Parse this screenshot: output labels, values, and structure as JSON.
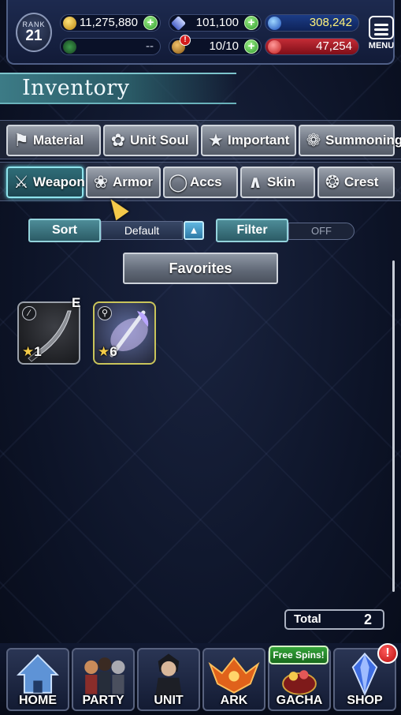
{
  "status": {
    "rank_label": "RANK",
    "rank_value": "21",
    "gil": "11,275,880",
    "lapis": "101,100",
    "visiore": "308,242",
    "exp": "--",
    "stamina": "10/10",
    "hp": "47,254",
    "stamina_alert": "!"
  },
  "menu": {
    "label": "MENU"
  },
  "title": "Inventory",
  "tabs_row1": [
    {
      "label": "Material",
      "icon": "sack-icon"
    },
    {
      "label": "Unit Soul",
      "icon": "soul-flame-icon"
    },
    {
      "label": "Important",
      "icon": "star-icon"
    },
    {
      "label": "Summoning",
      "icon": "summon-icon"
    }
  ],
  "tabs_row2": [
    {
      "label": "Weapon",
      "icon": "sword-icon",
      "active": true
    },
    {
      "label": "Armor",
      "icon": "armor-icon"
    },
    {
      "label": "Accs",
      "icon": "ring-icon"
    },
    {
      "label": "Skin",
      "icon": "hanger-icon"
    },
    {
      "label": "Crest",
      "icon": "crest-icon"
    }
  ],
  "sort": {
    "label": "Sort",
    "value": "Default"
  },
  "filter": {
    "label": "Filter",
    "value": "OFF"
  },
  "favorites": "Favorites",
  "items": [
    {
      "name": "dagger-weapon",
      "rarity": "1",
      "equipped_mark": "E",
      "frame": "silver"
    },
    {
      "name": "rod-weapon",
      "rarity": "6",
      "frame": "gold"
    }
  ],
  "total": {
    "label": "Total",
    "value": "2"
  },
  "nav": [
    {
      "label": "HOME"
    },
    {
      "label": "PARTY"
    },
    {
      "label": "UNIT"
    },
    {
      "label": "ARK"
    },
    {
      "label": "GACHA"
    },
    {
      "label": "SHOP"
    }
  ],
  "gacha_banner": "Free Spins!",
  "shop_badge": "!",
  "colors": {
    "accent_teal": "#4e8d98",
    "tab_active_border": "#8fe3ec",
    "hp_red": "#c42c36",
    "visiore_blue": "#1c3c86",
    "rarity_star": "#f3cb48"
  }
}
